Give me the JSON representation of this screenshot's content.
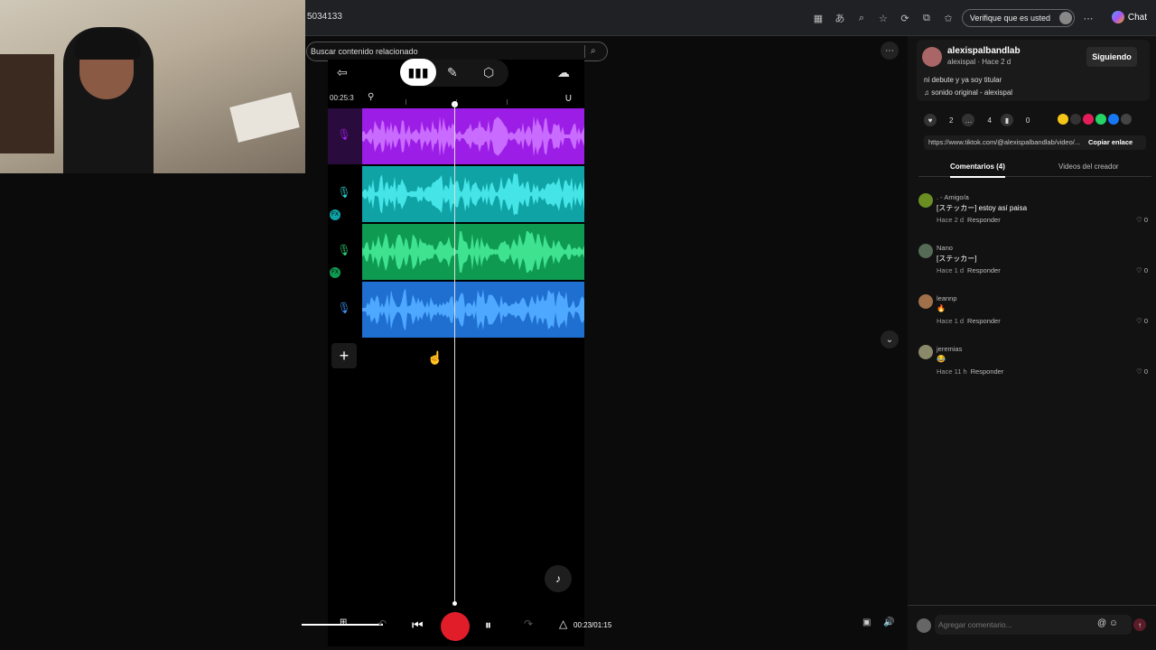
{
  "browser": {
    "url": "5034133",
    "verify_label": "Verifique que es usted",
    "chat_label": "Chat",
    "icons": [
      "app-icon",
      "translate-icon",
      "zoom-icon",
      "star-icon",
      "refresh-icon",
      "extension-icon",
      "favorites-icon",
      "more-icon"
    ]
  },
  "search": {
    "text": "Buscar contenido relacionado"
  },
  "bandlab": {
    "time": "00:25:3",
    "tracks": [
      {
        "color": "#9c1ee6",
        "wave": "#c96bff",
        "mic_color": "#9c1ee6",
        "fx": false
      },
      {
        "color": "#0fa3a6",
        "wave": "#45e4e6",
        "mic_color": "#2ec8c8",
        "fx": true
      },
      {
        "color": "#0f9a52",
        "wave": "#3fe38f",
        "mic_color": "#2ec86f",
        "fx": true
      },
      {
        "color": "#1e6fd0",
        "wave": "#4fa8ff",
        "mic_color": "#3a8de8",
        "fx": false
      }
    ],
    "fx_label": "FX",
    "transport_time": "00:23/01:15"
  },
  "sidebar": {
    "author_name": "alexispalbandlab",
    "author_meta": "alexispal · Hace 2 d",
    "follow_label": "Siguiendo",
    "description": "ni debute y ya soy titular",
    "sound": "♫  sonido original - alexispal",
    "likes": "2",
    "comments_count": "4",
    "saves": "0",
    "link": "https://www.tiktok.com/@alexispalbandlab/video/...",
    "copy_label": "Copiar enlace",
    "tab_comments": "Comentarios (4)",
    "tab_videos": "Videos del creador",
    "comments": [
      {
        "name": ". - Amigo/a",
        "text": "[ステッカー] estoy así paisa",
        "time": "Hace 2 d",
        "reply": "Responder",
        "likes": "0"
      },
      {
        "name": "Nano",
        "text": "[ステッカー]",
        "time": "Hace 1 d",
        "reply": "Responder",
        "likes": "0"
      },
      {
        "name": "leannp",
        "text": "🔥",
        "time": "Hace 1 d",
        "reply": "Responder",
        "likes": "0"
      },
      {
        "name": "jeremias",
        "text": "😂",
        "time": "Hace 11 h",
        "reply": "Responder",
        "likes": "0"
      }
    ],
    "comment_placeholder": "Agregar comentario..."
  }
}
